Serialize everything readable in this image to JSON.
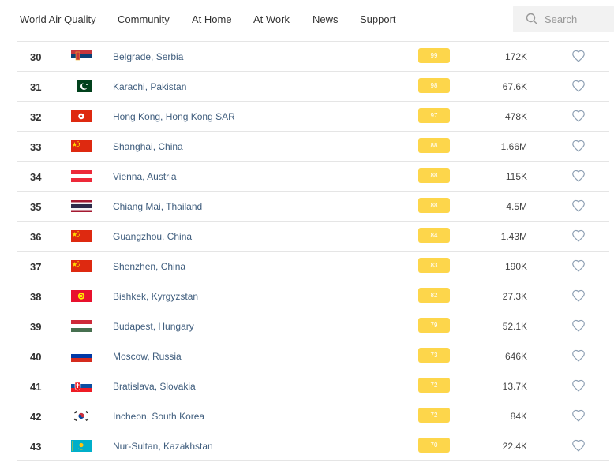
{
  "nav": {
    "brand": "World Air Quality",
    "items": [
      "Community",
      "At Home",
      "At Work",
      "News",
      "Support"
    ]
  },
  "search": {
    "placeholder": "Search"
  },
  "colors": {
    "aqi_badge": "#fdd64b",
    "city_link": "#3f5d7d"
  },
  "rows": [
    {
      "rank": "30",
      "flag": "serbia-flag",
      "city": "Belgrade, Serbia",
      "aqi": "99",
      "followers": "172K"
    },
    {
      "rank": "31",
      "flag": "pakistan-flag",
      "city": "Karachi, Pakistan",
      "aqi": "98",
      "followers": "67.6K"
    },
    {
      "rank": "32",
      "flag": "hong-kong-flag",
      "city": "Hong Kong, Hong Kong SAR",
      "aqi": "97",
      "followers": "478K"
    },
    {
      "rank": "33",
      "flag": "china-flag",
      "city": "Shanghai, China",
      "aqi": "88",
      "followers": "1.66M"
    },
    {
      "rank": "34",
      "flag": "austria-flag",
      "city": "Vienna, Austria",
      "aqi": "88",
      "followers": "115K"
    },
    {
      "rank": "35",
      "flag": "thailand-flag",
      "city": "Chiang Mai, Thailand",
      "aqi": "88",
      "followers": "4.5M"
    },
    {
      "rank": "36",
      "flag": "china-flag",
      "city": "Guangzhou, China",
      "aqi": "84",
      "followers": "1.43M"
    },
    {
      "rank": "37",
      "flag": "china-flag",
      "city": "Shenzhen, China",
      "aqi": "83",
      "followers": "190K"
    },
    {
      "rank": "38",
      "flag": "kyrgyzstan-flag",
      "city": "Bishkek, Kyrgyzstan",
      "aqi": "82",
      "followers": "27.3K"
    },
    {
      "rank": "39",
      "flag": "hungary-flag",
      "city": "Budapest, Hungary",
      "aqi": "79",
      "followers": "52.1K"
    },
    {
      "rank": "40",
      "flag": "russia-flag",
      "city": "Moscow, Russia",
      "aqi": "73",
      "followers": "646K"
    },
    {
      "rank": "41",
      "flag": "slovakia-flag",
      "city": "Bratislava, Slovakia",
      "aqi": "72",
      "followers": "13.7K"
    },
    {
      "rank": "42",
      "flag": "south-korea-flag",
      "city": "Incheon, South Korea",
      "aqi": "72",
      "followers": "84K"
    },
    {
      "rank": "43",
      "flag": "kazakhstan-flag",
      "city": "Nur-Sultan, Kazakhstan",
      "aqi": "70",
      "followers": "22.4K"
    }
  ]
}
